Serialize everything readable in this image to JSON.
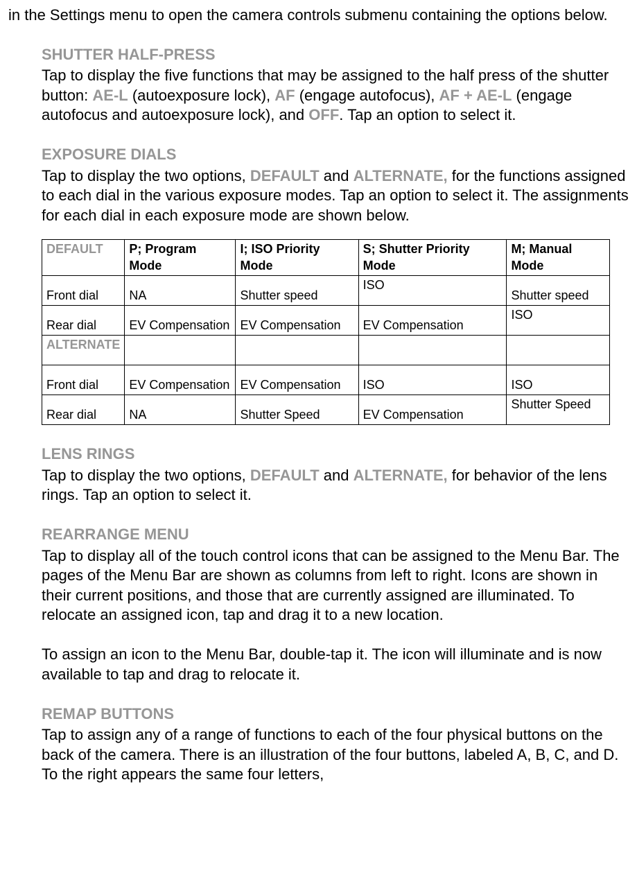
{
  "intro": "in the Settings menu to open the camera controls submenu containing the options below.",
  "shutter": {
    "heading": "SHUTTER HALF-PRESS",
    "p1a": "Tap to display the five functions that may be assigned to the half press of the shutter button: ",
    "ael": "AE-L",
    "p1b": " (autoexposure lock), ",
    "af": "AF",
    "p1c": " (engage autofocus), ",
    "afael": "AF + AE-L",
    "p1d": " (engage autofocus and autoexposure lock), and ",
    "off": "OFF",
    "p1e": ". Tap an option to select it."
  },
  "exposure": {
    "heading": "EXPOSURE DIALS",
    "p1a": "Tap to display the two options, ",
    "def": "DEFAULT",
    "p1b": " and ",
    "alt": "ALTERNATE,",
    "p1c": " for the functions assigned to each dial in the various exposure modes. Tap an option to select it. The assignments for each dial in each exposure mode are shown below."
  },
  "table": {
    "r1": [
      "DEFAULT",
      "P; Program Mode",
      "I; ISO Priority Mode",
      "S; Shutter Priority Mode",
      "M; Manual Mode"
    ],
    "r2": [
      "Front dial",
      "NA",
      "Shutter speed",
      "ISO",
      "Shutter speed"
    ],
    "r3": [
      "Rear dial",
      "EV Compensation",
      "EV Compensation",
      "EV Compensation",
      "ISO"
    ],
    "r4": [
      "ALTERNATE",
      "",
      "",
      "",
      ""
    ],
    "r5": [
      "Front dial",
      "EV Compensation",
      "EV Compensation",
      "ISO",
      "ISO"
    ],
    "r6": [
      "Rear dial",
      "NA",
      "Shutter Speed",
      "EV Compensation",
      "Shutter Speed"
    ]
  },
  "lens": {
    "heading": "LENS RINGS",
    "p1a": "Tap to display the two options, ",
    "def": "DEFAULT",
    "p1b": " and ",
    "alt": "ALTERNATE,",
    "p1c": " for behavior of the lens rings. Tap an option to select it."
  },
  "rearrange": {
    "heading": "REARRANGE MENU",
    "p1": "Tap to display all of the touch control icons that can be assigned to the Menu Bar. The pages of the Menu Bar are shown as columns from left to right. Icons are shown in their current positions, and those that are currently assigned are illuminated. To relocate an assigned icon, tap and drag it to a new location.",
    "p2": "To assign an icon to the Menu Bar, double-tap it. The icon will illuminate and is now available to tap and drag to relocate it."
  },
  "remap": {
    "heading": "REMAP BUTTONS",
    "p1": "Tap to assign any of a range of functions to each of the four physical buttons on the back of the camera. There is an illustration of the four buttons, labeled A, B, C, and D. To the right appears the same four letters,"
  }
}
